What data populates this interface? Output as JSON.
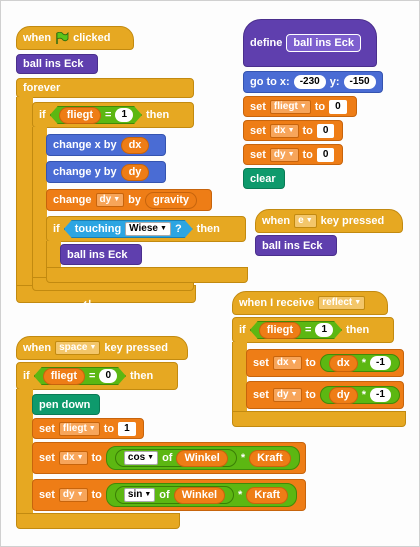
{
  "script_when_flag": {
    "hat_when": "when",
    "hat_clicked": "clicked",
    "call_ball": "ball ins Eck",
    "forever": "forever",
    "if1_kw": "if",
    "if1_var": "fliegt",
    "if1_eq": "=",
    "if1_val": "1",
    "if1_then": "then",
    "change_x_label": "change x by",
    "change_x_val": "dx",
    "change_y_label": "change y by",
    "change_y_val": "dy",
    "change_var_label": "change",
    "change_var_name": "dy",
    "change_var_by": "by",
    "change_var_val": "gravity",
    "if2_kw": "if",
    "if2_touching": "touching",
    "if2_touch_target": "Wiese",
    "if2_q": "?",
    "if2_then": "then",
    "if2_call": "ball ins Eck"
  },
  "script_define": {
    "define_kw": "define",
    "define_name": "ball ins Eck",
    "goto_label": "go to x:",
    "goto_x": "-230",
    "goto_y_label": "y:",
    "goto_y": "-150",
    "set1_label": "set",
    "set1_var": "fliegt",
    "set1_to": "to",
    "set1_val": "0",
    "set2_label": "set",
    "set2_var": "dx",
    "set2_to": "to",
    "set2_val": "0",
    "set3_label": "set",
    "set3_var": "dy",
    "set3_to": "to",
    "set3_val": "0",
    "clear": "clear"
  },
  "script_key_e": {
    "when": "when",
    "key": "e",
    "key_pressed": "key pressed",
    "call": "ball ins Eck"
  },
  "script_receive": {
    "when_receive": "when I receive",
    "message": "reflect",
    "if_kw": "if",
    "if_var": "fliegt",
    "if_eq": "=",
    "if_val": "1",
    "if_then": "then",
    "set1_label": "set",
    "set1_var": "dx",
    "set1_to": "to",
    "set1_a": "dx",
    "set1_op": "*",
    "set1_b": "-1",
    "set2_label": "set",
    "set2_var": "dy",
    "set2_to": "to",
    "set2_a": "dy",
    "set2_op": "*",
    "set2_b": "-1"
  },
  "script_space": {
    "when": "when",
    "key": "space",
    "key_pressed": "key pressed",
    "if_kw": "if",
    "if_var": "fliegt",
    "if_eq": "=",
    "if_val": "0",
    "if_then": "then",
    "pen_down": "pen down",
    "set1_label": "set",
    "set1_var": "fliegt",
    "set1_to": "to",
    "set1_val": "1",
    "set2_label": "set",
    "set2_var": "dx",
    "set2_to": "to",
    "set2_fn": "cos",
    "set2_of": "of",
    "set2_arg": "Winkel",
    "set2_op": "*",
    "set2_b": "Kraft",
    "set3_label": "set",
    "set3_var": "dy",
    "set3_to": "to",
    "set3_fn": "sin",
    "set3_of": "of",
    "set3_arg": "Winkel",
    "set3_op": "*",
    "set3_b": "Kraft"
  },
  "colors": {
    "control": "#e6a822",
    "motion": "#4a6cd4",
    "data": "#ee7d16",
    "pen": "#0e9a6c",
    "more_blocks": "#5f3fae",
    "operators": "#5cb712",
    "sensing": "#2ca5e2"
  }
}
